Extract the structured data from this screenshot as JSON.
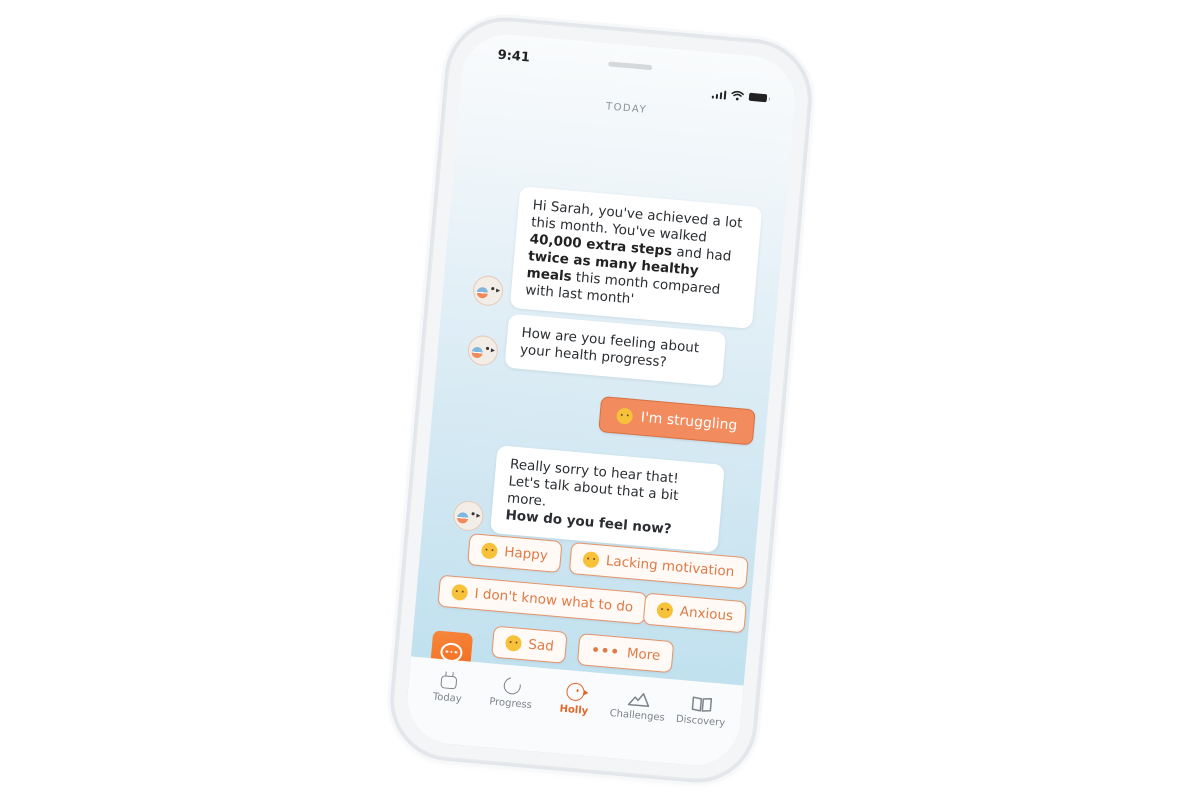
{
  "status_bar": {
    "time": "9:41",
    "signal_icon": "cellular-signal-icon",
    "wifi_icon": "wifi-icon",
    "battery_icon": "battery-icon"
  },
  "header": {
    "title": "TODAY"
  },
  "messages": [
    {
      "sender": "bot",
      "avatar": "holly-bird-avatar",
      "parts": [
        {
          "text": "Hi Sarah, you've achieved a lot this month. You've walked ",
          "bold": false
        },
        {
          "text": "40,000 extra steps",
          "bold": true
        },
        {
          "text": " and had ",
          "bold": false
        },
        {
          "text": "twice as many healthy meals",
          "bold": true
        },
        {
          "text": " this month compared with last month'",
          "bold": false
        }
      ]
    },
    {
      "sender": "bot",
      "avatar": "holly-bird-avatar",
      "parts": [
        {
          "text": "How are you feeling about your health progress?",
          "bold": false
        }
      ]
    },
    {
      "sender": "user",
      "emoji": "disappointed-face",
      "text": "I'm struggling"
    },
    {
      "sender": "bot",
      "avatar": "holly-bird-avatar",
      "line1": "Really sorry to hear that!",
      "line2": "Let's talk about that a bit more.",
      "line3": "How do you feel now?"
    }
  ],
  "quick_replies": [
    {
      "emoji": "smiling-face",
      "label": "Happy"
    },
    {
      "emoji": "neutral-face",
      "label": "Lacking motivation"
    },
    {
      "emoji": "expressionless-face",
      "label": "I don't know what to do"
    },
    {
      "emoji": "pleading-face",
      "label": "Anxious"
    },
    {
      "emoji": "sad-sweat-face",
      "label": "Sad"
    },
    {
      "emoji": "ellipsis",
      "label": "More",
      "prefix": "•••"
    }
  ],
  "chat_button": {
    "icon": "chat-bubble-icon"
  },
  "colors": {
    "accent": "#f26b1d",
    "user_bubble": "#f28c5e",
    "chip_text": "#e07a45",
    "tab_active": "#e0662a",
    "tab_inactive": "#7d838b"
  },
  "tabs": [
    {
      "label": "Today",
      "icon": "calendar-icon",
      "active": false
    },
    {
      "label": "Progress",
      "icon": "progress-ring-icon",
      "active": false
    },
    {
      "label": "Holly",
      "icon": "holly-bird-icon",
      "active": true
    },
    {
      "label": "Challenges",
      "icon": "mountain-icon",
      "active": false
    },
    {
      "label": "Discovery",
      "icon": "book-icon",
      "active": false
    }
  ]
}
